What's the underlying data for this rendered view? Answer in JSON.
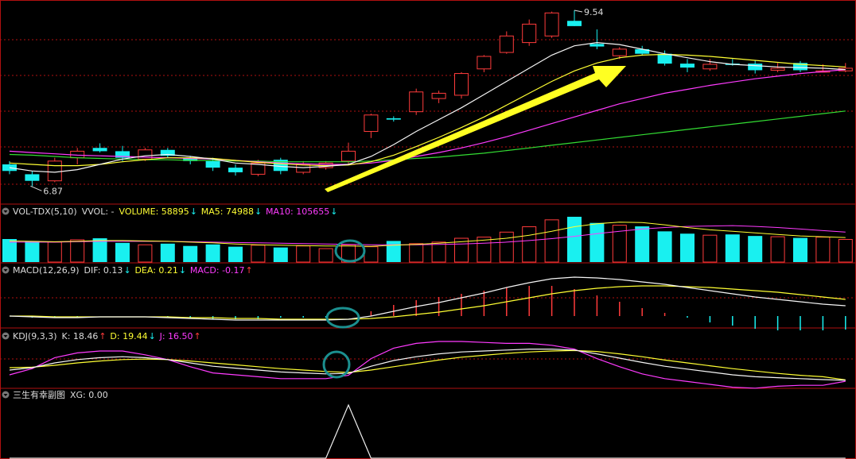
{
  "colors": {
    "up": "#ff3b3b",
    "down": "#19f0f0",
    "ma_white": "#f5f5f5",
    "ma_yellow": "#ffff33",
    "ma_magenta": "#ff3bff",
    "ma_green": "#33dd33",
    "circle": "#1b8f8f",
    "arrow": "#ffff22",
    "frame": "#b01010"
  },
  "price": {
    "high_label": "9.54",
    "low_label": "6.87"
  },
  "vol_panel": {
    "header": [
      {
        "text": "VOL-TDX(5,10)",
        "color": "#dcdcdc"
      },
      {
        "text": "VVOL: -",
        "color": "#dcdcdc"
      },
      {
        "text": "VOLUME: 58895",
        "color": "#ffff33",
        "arrow": "↓",
        "arrow_color": "#19f0f0"
      },
      {
        "text": "MA5: 74988",
        "color": "#ffff33",
        "arrow": "↓",
        "arrow_color": "#19f0f0"
      },
      {
        "text": "MA10: 105655",
        "color": "#ff3bff",
        "arrow": "↓",
        "arrow_color": "#19f0f0"
      }
    ]
  },
  "macd_panel": {
    "header": [
      {
        "text": "MACD(12,26,9)",
        "color": "#dcdcdc"
      },
      {
        "text": "DIF: 0.13",
        "color": "#dcdcdc",
        "arrow": "↓",
        "arrow_color": "#19f0f0"
      },
      {
        "text": "DEA: 0.21",
        "color": "#ffff33",
        "arrow": "↓",
        "arrow_color": "#19f0f0"
      },
      {
        "text": "MACD: -0.17",
        "color": "#ff3bff",
        "arrow": "↑",
        "arrow_color": "#ff3b3b"
      }
    ]
  },
  "kdj_panel": {
    "header": [
      {
        "text": "KDJ(9,3,3)",
        "color": "#dcdcdc"
      },
      {
        "text": "K: 18.46",
        "color": "#dcdcdc",
        "arrow": "↑",
        "arrow_color": "#ff3b3b"
      },
      {
        "text": "D: 19.44",
        "color": "#ffff33",
        "arrow": "↓",
        "arrow_color": "#19f0f0"
      },
      {
        "text": "J: 16.50",
        "color": "#ff3bff",
        "arrow": "↑",
        "arrow_color": "#ff3b3b"
      }
    ]
  },
  "xg_panel": {
    "header": [
      {
        "text": "三生有幸副图",
        "color": "#dcdcdc"
      },
      {
        "text": "XG: 0.00",
        "color": "#dcdcdc"
      }
    ]
  },
  "chart_data": [
    {
      "type": "candlestick",
      "count": 38,
      "candles": [
        [
          7.2,
          7.25,
          7.05,
          7.1
        ],
        [
          7.05,
          7.1,
          6.87,
          6.95
        ],
        [
          6.95,
          7.3,
          6.93,
          7.25
        ],
        [
          7.3,
          7.45,
          7.2,
          7.4
        ],
        [
          7.45,
          7.52,
          7.38,
          7.4
        ],
        [
          7.4,
          7.48,
          7.25,
          7.3
        ],
        [
          7.28,
          7.45,
          7.25,
          7.42
        ],
        [
          7.42,
          7.45,
          7.3,
          7.33
        ],
        [
          7.3,
          7.33,
          7.2,
          7.25
        ],
        [
          7.25,
          7.3,
          7.1,
          7.15
        ],
        [
          7.15,
          7.2,
          7.03,
          7.08
        ],
        [
          7.05,
          7.27,
          7.02,
          7.22
        ],
        [
          7.27,
          7.3,
          7.05,
          7.1
        ],
        [
          7.08,
          7.25,
          7.05,
          7.2
        ],
        [
          7.15,
          7.25,
          7.12,
          7.22
        ],
        [
          7.25,
          7.53,
          7.2,
          7.4
        ],
        [
          7.7,
          7.97,
          7.6,
          7.95
        ],
        [
          7.9,
          7.93,
          7.85,
          7.88
        ],
        [
          8.0,
          8.35,
          7.95,
          8.3
        ],
        [
          8.2,
          8.32,
          8.13,
          8.28
        ],
        [
          8.25,
          8.6,
          8.2,
          8.58
        ],
        [
          8.65,
          8.86,
          8.6,
          8.84
        ],
        [
          8.9,
          9.22,
          8.88,
          9.15
        ],
        [
          9.05,
          9.4,
          9.0,
          9.33
        ],
        [
          9.15,
          9.52,
          9.12,
          9.5
        ],
        [
          9.38,
          9.54,
          9.3,
          9.3
        ],
        [
          9.03,
          9.25,
          8.95,
          8.99
        ],
        [
          8.85,
          8.98,
          8.8,
          8.95
        ],
        [
          8.95,
          9.0,
          8.85,
          8.88
        ],
        [
          8.88,
          8.93,
          8.7,
          8.73
        ],
        [
          8.73,
          8.8,
          8.6,
          8.67
        ],
        [
          8.65,
          8.8,
          8.62,
          8.72
        ],
        [
          8.73,
          8.8,
          8.7,
          8.71
        ],
        [
          8.73,
          8.78,
          8.58,
          8.63
        ],
        [
          8.63,
          8.74,
          8.6,
          8.66
        ],
        [
          8.74,
          8.77,
          8.6,
          8.63
        ],
        [
          8.6,
          8.72,
          8.6,
          8.62
        ],
        [
          8.62,
          8.74,
          8.6,
          8.66
        ]
      ],
      "ma_white": [
        7.15,
        7.1,
        7.08,
        7.12,
        7.2,
        7.28,
        7.33,
        7.35,
        7.32,
        7.28,
        7.22,
        7.2,
        7.17,
        7.15,
        7.17,
        7.2,
        7.32,
        7.5,
        7.7,
        7.88,
        8.06,
        8.26,
        8.46,
        8.66,
        8.86,
        9.0,
        9.05,
        9.02,
        8.95,
        8.88,
        8.82,
        8.76,
        8.72,
        8.7,
        8.68,
        8.67,
        8.66,
        8.64
      ],
      "ma_yellow": [
        7.22,
        7.2,
        7.18,
        7.18,
        7.2,
        7.24,
        7.27,
        7.3,
        7.3,
        7.29,
        7.26,
        7.23,
        7.21,
        7.19,
        7.18,
        7.19,
        7.24,
        7.34,
        7.47,
        7.61,
        7.76,
        7.92,
        8.1,
        8.28,
        8.46,
        8.62,
        8.74,
        8.82,
        8.86,
        8.87,
        8.86,
        8.84,
        8.81,
        8.78,
        8.75,
        8.72,
        8.7,
        8.68
      ],
      "ma_magenta": [
        7.4,
        7.38,
        7.36,
        7.34,
        7.33,
        7.32,
        7.31,
        7.3,
        7.29,
        7.28,
        7.26,
        7.24,
        7.22,
        7.21,
        7.2,
        7.2,
        7.22,
        7.26,
        7.32,
        7.38,
        7.45,
        7.53,
        7.62,
        7.72,
        7.82,
        7.92,
        8.02,
        8.12,
        8.2,
        8.28,
        8.34,
        8.4,
        8.45,
        8.5,
        8.54,
        8.58,
        8.61,
        8.64
      ],
      "ma_green": [
        7.35,
        7.34,
        7.32,
        7.3,
        7.29,
        7.28,
        7.27,
        7.27,
        7.26,
        7.26,
        7.25,
        7.25,
        7.24,
        7.24,
        7.24,
        7.24,
        7.25,
        7.27,
        7.29,
        7.31,
        7.34,
        7.37,
        7.41,
        7.45,
        7.49,
        7.53,
        7.57,
        7.61,
        7.65,
        7.69,
        7.73,
        7.77,
        7.81,
        7.85,
        7.89,
        7.93,
        7.97,
        8.01
      ]
    },
    {
      "type": "bar",
      "name": "VOLUME",
      "values": [
        60,
        55,
        52,
        58,
        62,
        50,
        45,
        48,
        42,
        46,
        40,
        44,
        38,
        42,
        35,
        45,
        40,
        55,
        48,
        52,
        62,
        65,
        78,
        92,
        110,
        118,
        102,
        96,
        93,
        80,
        74,
        70,
        72,
        68,
        66,
        63,
        65,
        58895
      ],
      "ma5": [
        55,
        54,
        53,
        54,
        56,
        56,
        55,
        54,
        52,
        50,
        47,
        45,
        44,
        43,
        42,
        42,
        41,
        44,
        46,
        49,
        53,
        57,
        62,
        70,
        80,
        92,
        100,
        104,
        103,
        97,
        90,
        84,
        80,
        76,
        72,
        68,
        66,
        64
      ],
      "ma10": [
        52,
        52,
        52,
        53,
        54,
        54,
        54,
        54,
        53,
        52,
        51,
        50,
        49,
        48,
        47,
        46,
        45,
        45,
        45,
        46,
        47,
        49,
        52,
        56,
        61,
        67,
        74,
        80,
        86,
        90,
        93,
        94,
        95,
        93,
        90,
        86,
        82,
        78
      ]
    },
    {
      "type": "line",
      "name": "MACD",
      "dif": [
        0.0,
        -0.01,
        -0.02,
        -0.02,
        -0.01,
        -0.01,
        -0.01,
        -0.02,
        -0.03,
        -0.04,
        -0.05,
        -0.05,
        -0.05,
        -0.05,
        -0.05,
        -0.04,
        0.0,
        0.06,
        0.12,
        0.17,
        0.23,
        0.29,
        0.36,
        0.42,
        0.47,
        0.49,
        0.48,
        0.46,
        0.43,
        0.4,
        0.36,
        0.32,
        0.28,
        0.24,
        0.21,
        0.18,
        0.15,
        0.13
      ],
      "dea": [
        0.0,
        0.0,
        -0.01,
        -0.01,
        -0.01,
        -0.01,
        -0.01,
        -0.01,
        -0.02,
        -0.02,
        -0.03,
        -0.03,
        -0.04,
        -0.04,
        -0.04,
        -0.04,
        -0.03,
        -0.01,
        0.02,
        0.05,
        0.09,
        0.13,
        0.18,
        0.23,
        0.28,
        0.32,
        0.35,
        0.37,
        0.38,
        0.38,
        0.37,
        0.36,
        0.34,
        0.32,
        0.3,
        0.27,
        0.24,
        0.21
      ],
      "hist": [
        0.0,
        -0.02,
        -0.02,
        -0.02,
        0.0,
        0.0,
        0.0,
        -0.02,
        -0.02,
        -0.04,
        -0.04,
        -0.04,
        -0.02,
        -0.02,
        -0.02,
        0.0,
        0.06,
        0.14,
        0.2,
        0.24,
        0.28,
        0.32,
        0.36,
        0.38,
        0.38,
        0.34,
        0.26,
        0.18,
        0.1,
        0.04,
        -0.02,
        -0.08,
        -0.12,
        -0.16,
        -0.18,
        -0.18,
        -0.18,
        -0.17
      ]
    },
    {
      "type": "line",
      "name": "KDJ",
      "k": [
        40,
        45,
        55,
        62,
        66,
        68,
        66,
        62,
        55,
        48,
        44,
        40,
        36,
        34,
        32,
        33,
        48,
        60,
        68,
        74,
        78,
        80,
        82,
        84,
        84,
        82,
        74,
        65,
        56,
        48,
        42,
        36,
        30,
        26,
        24,
        22,
        20,
        18.46
      ],
      "d": [
        45,
        46,
        50,
        55,
        59,
        62,
        63,
        62,
        59,
        55,
        51,
        47,
        43,
        40,
        37,
        35,
        40,
        47,
        54,
        61,
        67,
        71,
        75,
        78,
        80,
        81,
        79,
        74,
        68,
        61,
        55,
        49,
        43,
        38,
        33,
        29,
        26,
        19.44
      ],
      "j": [
        30,
        43,
        66,
        76,
        80,
        80,
        72,
        62,
        47,
        34,
        30,
        26,
        22,
        22,
        22,
        29,
        64,
        86,
        96,
        100,
        100,
        98,
        96,
        96,
        92,
        84,
        64,
        47,
        32,
        22,
        16,
        10,
        4,
        2,
        6,
        8,
        8,
        16.5
      ]
    },
    {
      "type": "line",
      "name": "XG",
      "values": [
        0,
        0,
        0,
        0,
        0,
        0,
        0,
        0,
        0,
        0,
        0,
        0,
        0,
        0,
        0,
        1,
        0,
        0,
        0,
        0,
        0,
        0,
        0,
        0,
        0,
        0,
        0,
        0,
        0,
        0,
        0,
        0,
        0,
        0,
        0,
        0,
        0,
        0
      ]
    }
  ]
}
